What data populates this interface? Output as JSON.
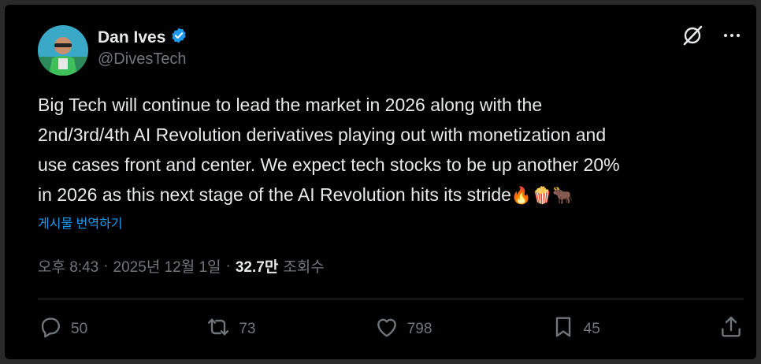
{
  "author": {
    "name": "Dan Ives",
    "handle": "@DivesTech",
    "verified": true
  },
  "post": {
    "text": "Big Tech will continue to lead the market in 2026 along with the\n2nd/3rd/4th AI Revolution derivatives playing out with monetization and\nuse cases front and center. We expect tech stocks to be up another 20%\nin 2026 as this next stage of the AI Revolution hits its stride",
    "emojis": "🔥🍿🐂",
    "translate_label": "게시물 번역하기",
    "time": "오후 8:43",
    "date": "2025년 12월 1일",
    "separator": "·",
    "views_count": "32.7만",
    "views_label": "조회수"
  },
  "actions": {
    "replies": "50",
    "reposts": "73",
    "likes": "798",
    "bookmarks": "45"
  },
  "colors": {
    "accent": "#1d9bf0",
    "muted": "#71767b",
    "text": "#e7e9ea",
    "background": "#000000"
  },
  "icons": [
    "verified-badge-icon",
    "grok-icon",
    "more-icon",
    "reply-icon",
    "repost-icon",
    "like-icon",
    "bookmark-icon",
    "share-icon"
  ]
}
